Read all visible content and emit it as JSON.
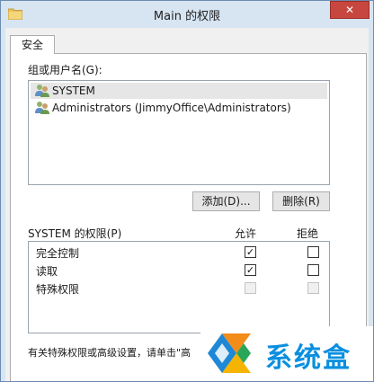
{
  "window": {
    "title": "Main 的权限",
    "close_label": "✕"
  },
  "tabs": [
    {
      "label": "安全",
      "selected": true
    }
  ],
  "groups": {
    "label": "组或用户名(G):",
    "users": [
      {
        "name": "SYSTEM",
        "icon": "user-group-icon",
        "selected": true
      },
      {
        "name": "Administrators (JimmyOffice\\Administrators)",
        "icon": "user-group-icon",
        "selected": false
      }
    ]
  },
  "buttons": {
    "add_label": "添加(D)...",
    "remove_label": "删除(R)"
  },
  "permissions": {
    "title": "SYSTEM 的权限(P)",
    "allow_header": "允许",
    "deny_header": "拒绝",
    "rows": [
      {
        "name": "完全控制",
        "allow": true,
        "deny": false,
        "enabled": true
      },
      {
        "name": "读取",
        "allow": true,
        "deny": false,
        "enabled": true
      },
      {
        "name": "特殊权限",
        "allow": false,
        "deny": false,
        "enabled": false
      }
    ]
  },
  "footer": {
    "text": "有关特殊权限或高级设置，请单击\"高"
  },
  "watermark": {
    "text": "系统盒"
  },
  "colors": {
    "titlebar": "#d7e4f2",
    "close_button": "#c7473e",
    "selection": "#e6e6e6",
    "watermark_text": "#0a8fe0"
  }
}
